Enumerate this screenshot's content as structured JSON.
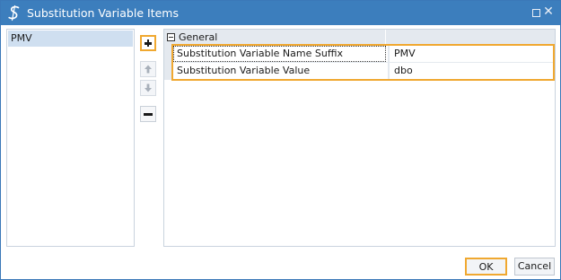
{
  "window": {
    "title": "Substitution Variable Items",
    "app_icon": "script-s-icon",
    "controls": {
      "maximize_icon": "maximize-icon",
      "close_glyph": "✕"
    }
  },
  "left_list": {
    "items": [
      {
        "label": "PMV",
        "selected": true
      }
    ]
  },
  "toolbar": {
    "add_icon": "plus-icon",
    "up_icon": "arrow-up-icon",
    "down_icon": "arrow-down-icon",
    "remove_icon": "minus-icon"
  },
  "property_grid": {
    "category": "General",
    "category_expanded": true,
    "rows": [
      {
        "name": "Substitution Variable Name Suffix",
        "value": "PMV"
      },
      {
        "name": "Substitution Variable Value",
        "value": "dbo"
      }
    ]
  },
  "footer": {
    "ok_label": "OK",
    "cancel_label": "Cancel"
  },
  "colors": {
    "titlebar": "#3c7ebd",
    "focus_highlight": "#f0a830",
    "selection": "#cfdff0",
    "category_background": "#e4e9ef"
  }
}
